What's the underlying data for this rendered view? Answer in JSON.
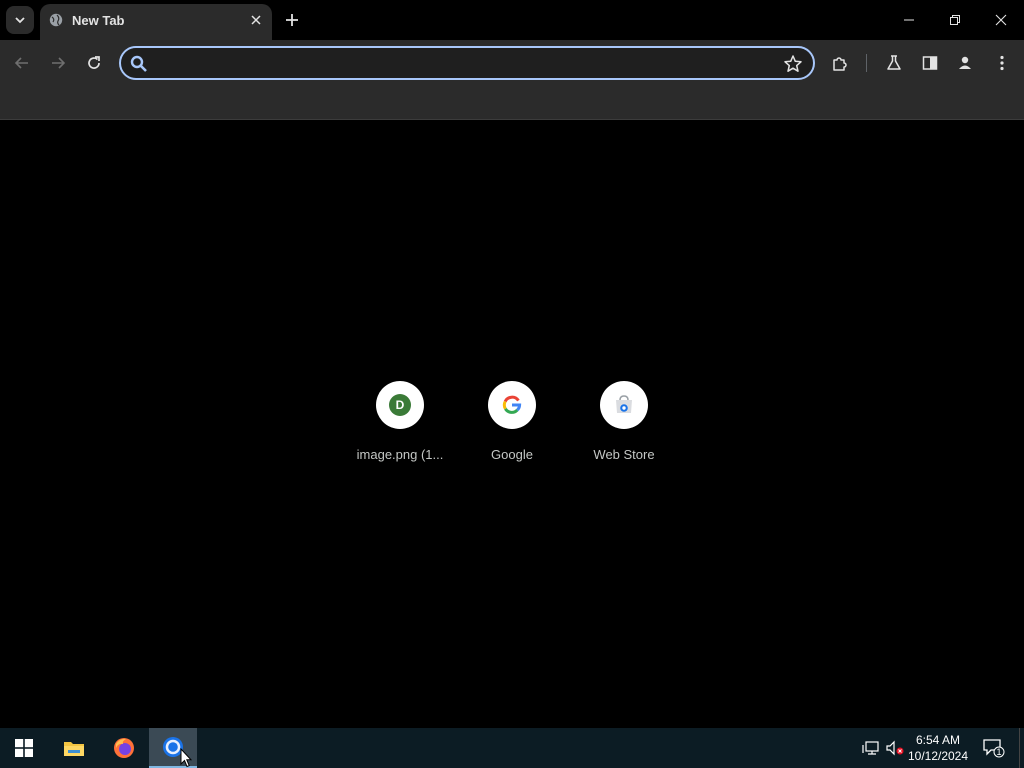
{
  "browser": {
    "tab": {
      "title": "New Tab"
    },
    "omnibox": {
      "value": "",
      "placeholder": ""
    }
  },
  "shortcuts": [
    {
      "label": "image.png (1...",
      "icon": "letter-d-avatar",
      "letter": "D"
    },
    {
      "label": "Google",
      "icon": "google-g-icon"
    },
    {
      "label": "Web Store",
      "icon": "web-store-icon"
    }
  ],
  "taskbar": {
    "apps": [
      "start-icon",
      "file-explorer-icon",
      "firefox-icon",
      "chrome-icon"
    ],
    "clock": {
      "time": "6:54 AM",
      "date": "10/12/2024"
    },
    "notification_count": "1"
  },
  "colors": {
    "accent": "#a8c7fa",
    "toolbar": "#2b2b2b",
    "content_background": "#000000",
    "taskbar": "#0c1c24"
  }
}
